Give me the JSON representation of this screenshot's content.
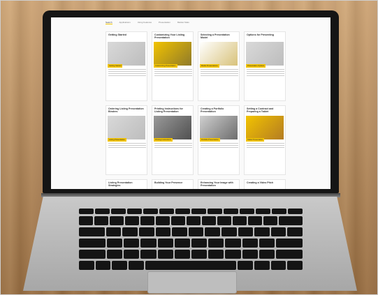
{
  "nav": {
    "items": [
      "Search",
      "Applications",
      "Using Features",
      "Presentation",
      "Market Stats"
    ],
    "active_index": 0
  },
  "cards": [
    {
      "title": "Getting Started",
      "tag": "Getting Started"
    },
    {
      "title": "Customizing Your Listing Presentation",
      "tag": "Customizing Presentation"
    },
    {
      "title": "Selecting a Presentation Model",
      "tag": "Model Presentations"
    },
    {
      "title": "Options for Presenting",
      "tag": "Presentation Options"
    },
    {
      "title": "Ordering Listing Presentation Binders",
      "tag": "Listing Presentation"
    },
    {
      "title": "Printing Instructions for Listing Presentation",
      "tag": "Printing Instructions"
    },
    {
      "title": "Creating a Portfolio Presentation",
      "tag": "Portfolio Presentation"
    },
    {
      "title": "Setting a Contract and Preparing a Tablet",
      "tag": "Tablet Presentation"
    },
    {
      "title": "Listing Presentation Strategies",
      "tag": ""
    },
    {
      "title": "Building Your Presence",
      "tag": ""
    },
    {
      "title": "Enhancing Your Image with Presentation",
      "tag": ""
    },
    {
      "title": "Creating a Video Pitch",
      "tag": ""
    }
  ],
  "colors": {
    "accent": "#f2c300",
    "bezel": "#151515",
    "keys": "#141414",
    "wood": "#b78a5a"
  }
}
